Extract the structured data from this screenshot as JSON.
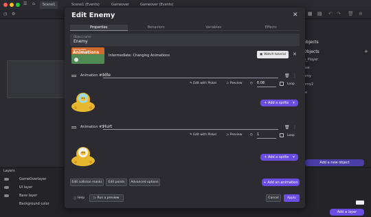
{
  "app": {
    "tabs": [
      "Scene1",
      "Scene1 (Events)",
      "Gameover",
      "Gameover (Events)"
    ],
    "right_panel": {
      "title": "objects",
      "section": "Objects",
      "items": [
        "n_Player",
        "ase",
        "emy",
        "emy2",
        "re"
      ],
      "add_object_label": "Add a new object"
    },
    "layers": {
      "title": "Layers",
      "rows": [
        "GameOverlayer",
        "UI layer",
        "Base layer",
        "Background color"
      ],
      "add_layer_label": "Add a layer"
    }
  },
  "modal": {
    "title": "Edit Enemy",
    "tabs": [
      "Properties",
      "Behaviors",
      "Variables",
      "Effects"
    ],
    "selected_tab": "Properties",
    "object_name_label": "Object name",
    "object_name_value": "Enemy",
    "tutorial": {
      "thumb_kicker": "Intermediate",
      "thumb_title": "Animations",
      "title": "Intermediate: Changing Animations",
      "watch_label": "Watch tutorial"
    },
    "animations": [
      {
        "label": "Animation #0",
        "name": "Idle",
        "edit_piskel": "Edit with Piskel",
        "preview": "Preview",
        "fps": "0.08",
        "loop": "Loop",
        "add_sprite": "Add a sprite"
      },
      {
        "label": "Animation #1",
        "name": "Hurt",
        "edit_piskel": "Edit with Piskel",
        "preview": "Preview",
        "fps": "1",
        "loop": "Loop",
        "add_sprite": "Add a sprite"
      }
    ],
    "buttons": {
      "collision_masks": "Edit collision masks",
      "points": "Edit points",
      "advanced": "Advanced options",
      "add_animation": "Add an animation",
      "help": "Help",
      "run_preview": "Run a preview",
      "cancel": "Cancel",
      "apply": "Apply"
    }
  },
  "colors": {
    "accent": "#6b4de6",
    "modal_bg": "#2b2b31",
    "app_bg": "#1f1f24"
  }
}
